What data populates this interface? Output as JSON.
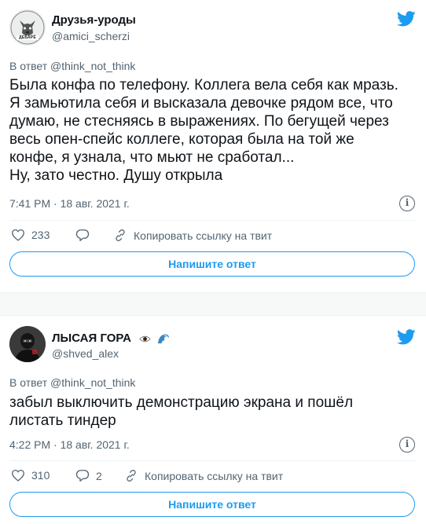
{
  "tweets": [
    {
      "author_name": "Друзья-уроды",
      "author_handle": "@amici_scherzi",
      "avatar_caption": "ДЕБАРЁ",
      "reply_prefix": "В ответ",
      "reply_to": "@think_not_think",
      "text_lines": [
        "Была конфа по телефону. Коллега вела себя как мразь.",
        "Я замьютила себя и высказала девочке рядом все, что",
        "думаю, не стесняясь в выражениях. По бегущей через",
        "весь опен-спейс коллеге, которая была на той же",
        "конфе, я узнала, что мьют не сработал...",
        "Ну, зато честно. Душу открыла"
      ],
      "time": "7:41 PM · 18 авг. 2021 г.",
      "likes": "233",
      "replies": "",
      "copy_link_label": "Копировать ссылку на твит",
      "reply_button_label": "Напишите ответ"
    },
    {
      "author_name": "ЛЫСАЯ ГОРА",
      "author_handle": "@shved_alex",
      "author_emojis": [
        "eye-emoji",
        "wave-emoji"
      ],
      "reply_prefix": "В ответ",
      "reply_to": "@think_not_think",
      "text_lines": [
        "забыл выключить демонстрацию экрана и пошёл",
        "листать тиндер"
      ],
      "time": "4:22 PM · 18 авг. 2021 г.",
      "likes": "310",
      "replies": "2",
      "copy_link_label": "Копировать ссылку на твит",
      "reply_button_label": "Напишите ответ"
    }
  ],
  "colors": {
    "accent": "#1d9bf0",
    "secondary_text": "#536471",
    "primary_text": "#0f1419",
    "divider": "#eff3f4"
  },
  "icons": [
    "twitter-bird-icon",
    "info-icon",
    "heart-icon",
    "reply-icon",
    "link-icon"
  ]
}
